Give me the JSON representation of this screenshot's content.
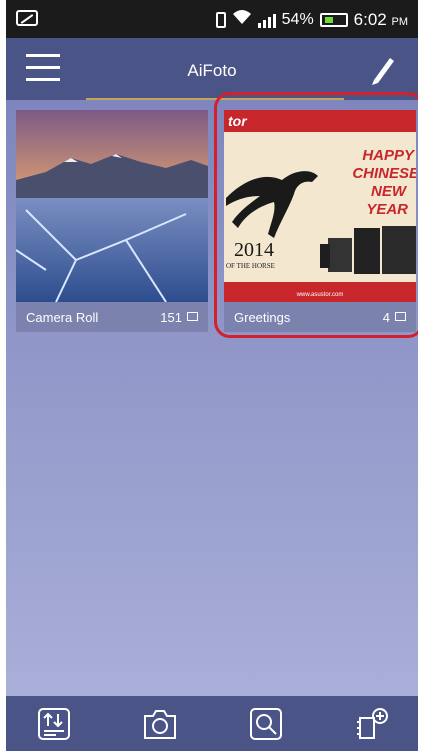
{
  "status": {
    "battery": "54%",
    "time": "6:02",
    "ampm": "PM"
  },
  "header": {
    "title": "AiFoto"
  },
  "albums": [
    {
      "name": "Camera Roll",
      "count": "151"
    },
    {
      "name": "Greetings",
      "count": "4"
    }
  ],
  "greeting_card": {
    "brand": "tor",
    "line1": "HAPPY",
    "line2": "CHINESE",
    "line3": "NEW",
    "line4": "YEAR",
    "year": "2014",
    "sub": "OF THE HORSE",
    "url": "www.asustor.com"
  },
  "colors": {
    "appbar": "#4a5486",
    "highlight": "#d3202c",
    "card_red": "#c7272b"
  }
}
